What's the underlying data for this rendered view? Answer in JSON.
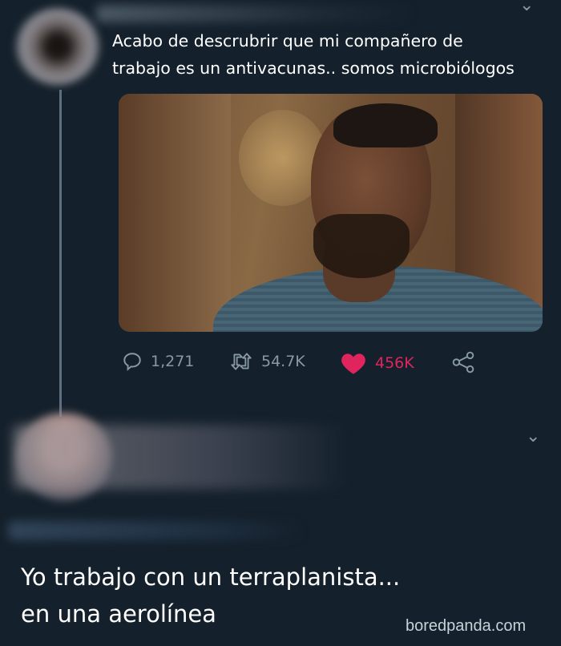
{
  "tweet1": {
    "text": "Acabo de descrubrir que mi compañero de\ntrabajo es un antivacunas.. somos microbiólogos",
    "stats": {
      "replies": "1,271",
      "retweets": "54.7K",
      "likes": "456K"
    },
    "menu_icon": "chevron-down-icon"
  },
  "tweet2": {
    "menu_icon": "chevron-down-icon"
  },
  "caption": "Yo trabajo con un terraplanista...\nen una aerolínea",
  "watermark": "boredpanda.com",
  "colors": {
    "background": "#14202b",
    "like": "#e0245e",
    "muted": "#8899a6"
  }
}
